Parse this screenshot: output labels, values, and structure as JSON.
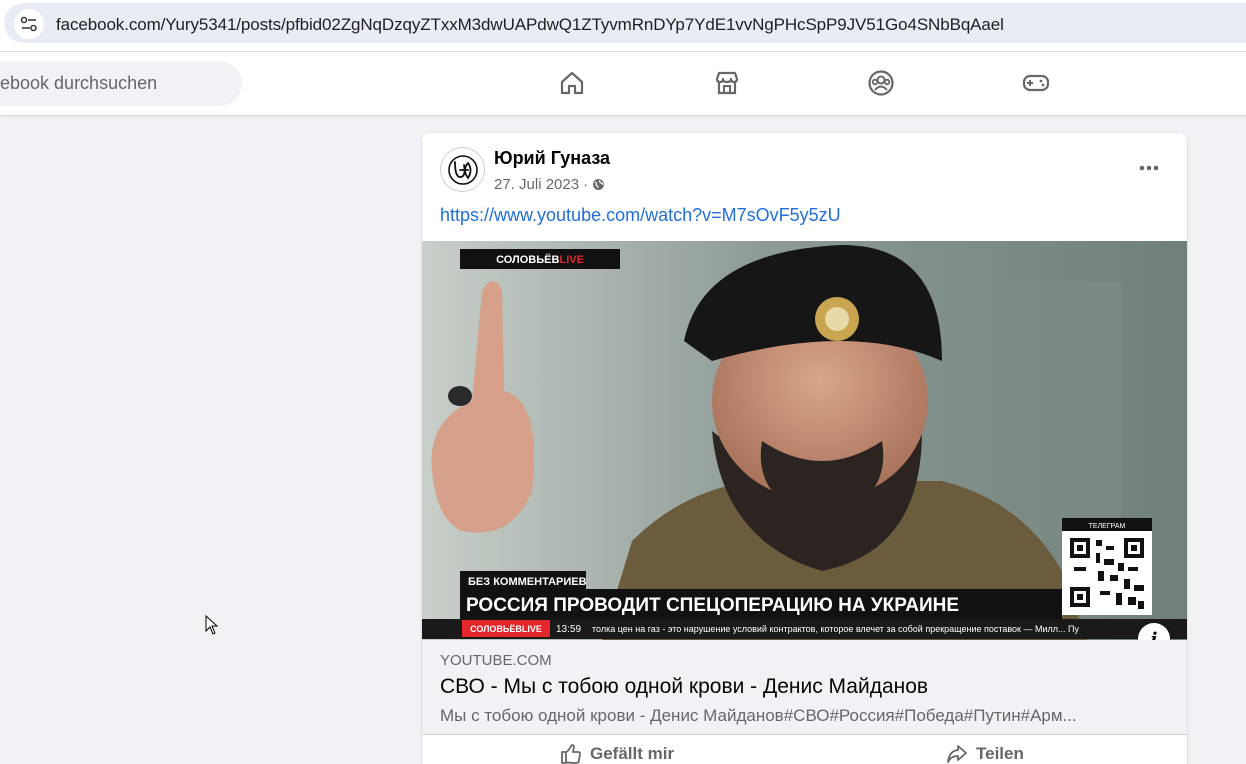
{
  "browser": {
    "url": "facebook.com/Yury5341/posts/pfbid02ZgNqDzqyZTxxM3dwUAPdwQ1ZTyvmRnDYp7YdE1vvNgPHcSpP9JV51Go4SNbBqAael"
  },
  "nav": {
    "search_placeholder": "ebook durchsuchen",
    "icons": [
      "home-icon",
      "marketplace-icon",
      "groups-icon",
      "gaming-icon"
    ]
  },
  "post": {
    "author": "Юрий Гуназа",
    "date": "27. Juli 2023",
    "separator": "·",
    "link": "https://www.youtube.com/watch?v=M7sOvF5y5zU",
    "video_overlay": {
      "channel_badge_main": "СОЛОВЬЁВ",
      "channel_badge_live": "LIVE",
      "subheadline": "БЕЗ КОММЕНТАРИЕВ",
      "headline": "РОССИЯ ПРОВОДИТ СПЕЦОПЕРАЦИЮ НА УКРАИНЕ",
      "ticker_channel": "СОЛОВЬЁВLIVE",
      "ticker_time": "13:59",
      "ticker_text": "толка цен на газ - это нарушение условий контрактов, которое влечет за собой прекращение поставок — Милл... Пу",
      "qr_label": "ТЕЛЕГРАМ"
    },
    "info_glyph": "i",
    "preview": {
      "domain": "YOUTUBE.COM",
      "title": "СВО - Мы с тобою одной крови - Денис Майданов",
      "description": "Мы с тобою одной крови - Денис Майданов#СВО#Россия#Победа#Путин#Арм..."
    },
    "actions": {
      "like_label": "Gefällt mir",
      "share_label": "Teilen"
    }
  },
  "colors": {
    "link": "#216fdb",
    "secondary_text": "#65676b",
    "page_bg": "#f0f2f5"
  }
}
